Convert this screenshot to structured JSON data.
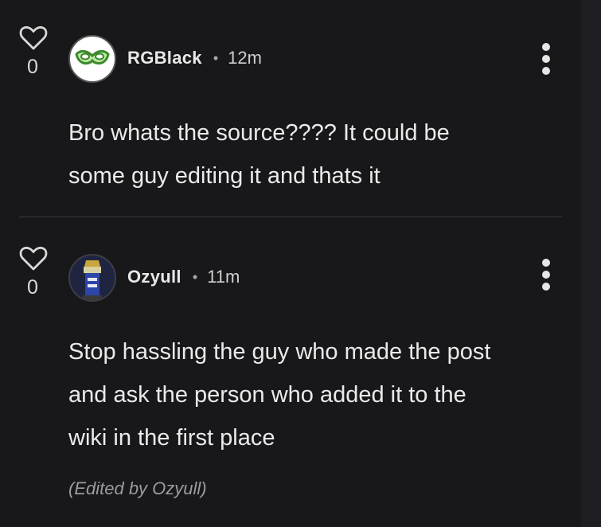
{
  "comments": [
    {
      "likes": "0",
      "username": "RGBlack",
      "separator": "•",
      "time": "12m",
      "lines": [
        "Bro whats the source???? It could be",
        "some guy editing it and thats it"
      ]
    },
    {
      "likes": "0",
      "username": "Ozyull",
      "separator": "•",
      "time": "11m",
      "lines": [
        "Stop hassling the guy who made the post",
        "and ask the person who added it to the",
        "wiki in the first place"
      ],
      "edited_note": "(Edited by Ozyull)"
    }
  ],
  "icons": {
    "like": "heart-outline-icon",
    "more": "vertical-ellipsis-icon"
  },
  "colors": {
    "background": "#18181b",
    "text": "#eaeaea",
    "muted": "#9c9c9c",
    "divider": "#3a3a40"
  }
}
